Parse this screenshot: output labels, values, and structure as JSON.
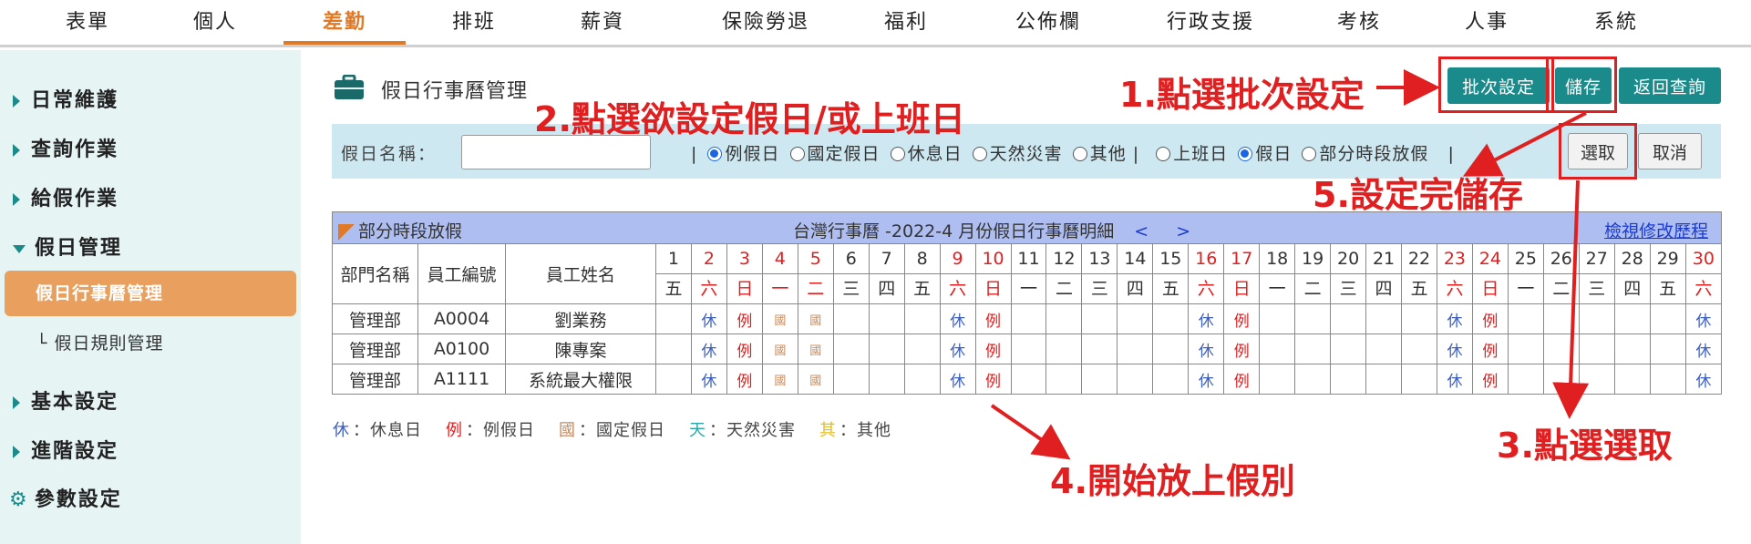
{
  "topnav": {
    "tabs": [
      {
        "label": "表單"
      },
      {
        "label": "個人"
      },
      {
        "label": "差勤",
        "active": true
      },
      {
        "label": "排班"
      },
      {
        "label": "薪資"
      },
      {
        "label": "保險勞退"
      },
      {
        "label": "福利"
      },
      {
        "label": "公佈欄"
      },
      {
        "label": "行政支援"
      },
      {
        "label": "考核"
      },
      {
        "label": "人事"
      },
      {
        "label": "系統"
      }
    ]
  },
  "sidebar": {
    "items": [
      {
        "label": "日常維護"
      },
      {
        "label": "查詢作業"
      },
      {
        "label": "給假作業"
      },
      {
        "label": "假日管理",
        "expanded": true
      },
      {
        "label": "基本設定"
      },
      {
        "label": "進階設定"
      },
      {
        "label": "參數設定"
      }
    ],
    "active_sub": "假日行事曆管理",
    "sub": "└ 假日規則管理"
  },
  "page": {
    "title": "假日行事曆管理",
    "buttons": {
      "batch": "批次設定",
      "save": "儲存",
      "back": "返回查詢",
      "select": "選取",
      "cancel": "取消"
    }
  },
  "filter": {
    "name_label": "假日名稱：",
    "name_value": "",
    "type_options": [
      "例假日",
      "國定假日",
      "休息日",
      "天然災害",
      "其他"
    ],
    "type_selected": "例假日",
    "mode_options": [
      "上班日",
      "假日",
      "部分時段放假"
    ],
    "mode_selected": "假日"
  },
  "calendar": {
    "partial_label": "部分時段放假",
    "title": "台灣行事曆 -2022-4 月份假日行事曆明細",
    "prev": "<",
    "next": ">",
    "history_link": "檢視修改歷程",
    "columns": [
      "部門名稱",
      "員工編號",
      "員工姓名"
    ],
    "days": [
      {
        "d": "1",
        "w": "五"
      },
      {
        "d": "2",
        "w": "六",
        "red": true
      },
      {
        "d": "3",
        "w": "日",
        "red": true
      },
      {
        "d": "4",
        "w": "一",
        "red": true
      },
      {
        "d": "5",
        "w": "二",
        "red": true
      },
      {
        "d": "6",
        "w": "三"
      },
      {
        "d": "7",
        "w": "四"
      },
      {
        "d": "8",
        "w": "五"
      },
      {
        "d": "9",
        "w": "六",
        "red": true
      },
      {
        "d": "10",
        "w": "日",
        "red": true
      },
      {
        "d": "11",
        "w": "一"
      },
      {
        "d": "12",
        "w": "二"
      },
      {
        "d": "13",
        "w": "三"
      },
      {
        "d": "14",
        "w": "四"
      },
      {
        "d": "15",
        "w": "五"
      },
      {
        "d": "16",
        "w": "六",
        "red": true
      },
      {
        "d": "17",
        "w": "日",
        "red": true
      },
      {
        "d": "18",
        "w": "一"
      },
      {
        "d": "19",
        "w": "二"
      },
      {
        "d": "20",
        "w": "三"
      },
      {
        "d": "21",
        "w": "四"
      },
      {
        "d": "22",
        "w": "五"
      },
      {
        "d": "23",
        "w": "六",
        "red": true
      },
      {
        "d": "24",
        "w": "日",
        "red": true
      },
      {
        "d": "25",
        "w": "一"
      },
      {
        "d": "26",
        "w": "二"
      },
      {
        "d": "27",
        "w": "三"
      },
      {
        "d": "28",
        "w": "四"
      },
      {
        "d": "29",
        "w": "五"
      },
      {
        "d": "30",
        "w": "六",
        "red": true
      }
    ],
    "rows": [
      {
        "dept": "管理部",
        "id": "A0004",
        "name": "劉業務"
      },
      {
        "dept": "管理部",
        "id": "A0100",
        "name": "陳專案"
      },
      {
        "dept": "管理部",
        "id": "A1111",
        "name": "系統最大權限"
      }
    ],
    "marks": {
      "2": "休",
      "3": "例",
      "4": "國",
      "5": "國",
      "9": "休",
      "10": "例",
      "16": "休",
      "17": "例",
      "23": "休",
      "24": "例",
      "30": "休"
    }
  },
  "legend": [
    {
      "key": "休",
      "label": "：休息日",
      "color": "#3d5fc0"
    },
    {
      "key": "例",
      "label": "：例假日",
      "color": "#e02020"
    },
    {
      "key": "國",
      "label": "：國定假日",
      "color": "#c8885a"
    },
    {
      "key": "天",
      "label": "：天然災害",
      "color": "#2aa8a8"
    },
    {
      "key": "其",
      "label": "：其他",
      "color": "#e0c020"
    }
  ],
  "annotations": {
    "a1": "1.點選批次設定",
    "a2": "2.點選欲設定假日/或上班日",
    "a3": "3.點選選取",
    "a4": "4.開始放上假別",
    "a5": "5.設定完儲存"
  }
}
